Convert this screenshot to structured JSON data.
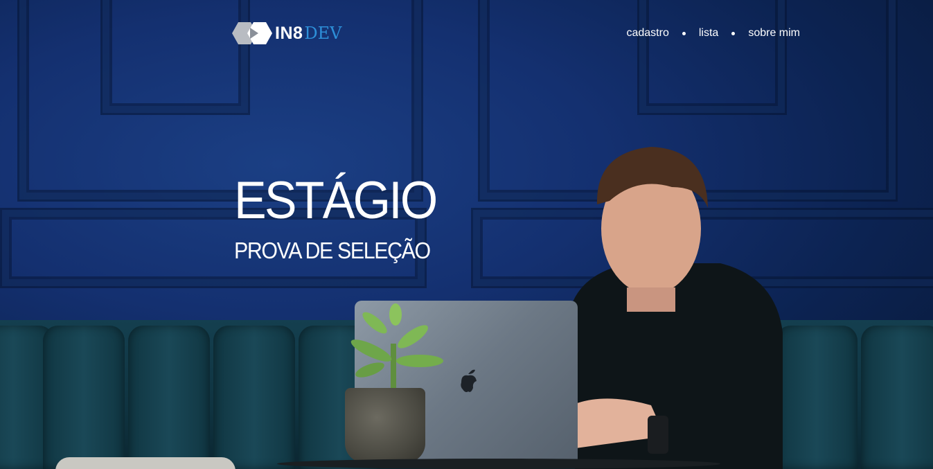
{
  "header": {
    "logo": {
      "text_primary": "IN8",
      "text_secondary": "DEV",
      "icon": "in8-hexagon-logo-icon"
    },
    "nav": [
      {
        "label": "cadastro"
      },
      {
        "label": "lista"
      },
      {
        "label": "sobre mim"
      }
    ]
  },
  "hero": {
    "title": "ESTÁGIO",
    "subtitle": "PROVA DE SELEÇÃO",
    "image": "man-with-laptop-photo"
  },
  "colors": {
    "accent": "#2d8fd8",
    "background": "#143070",
    "text": "#ffffff"
  }
}
